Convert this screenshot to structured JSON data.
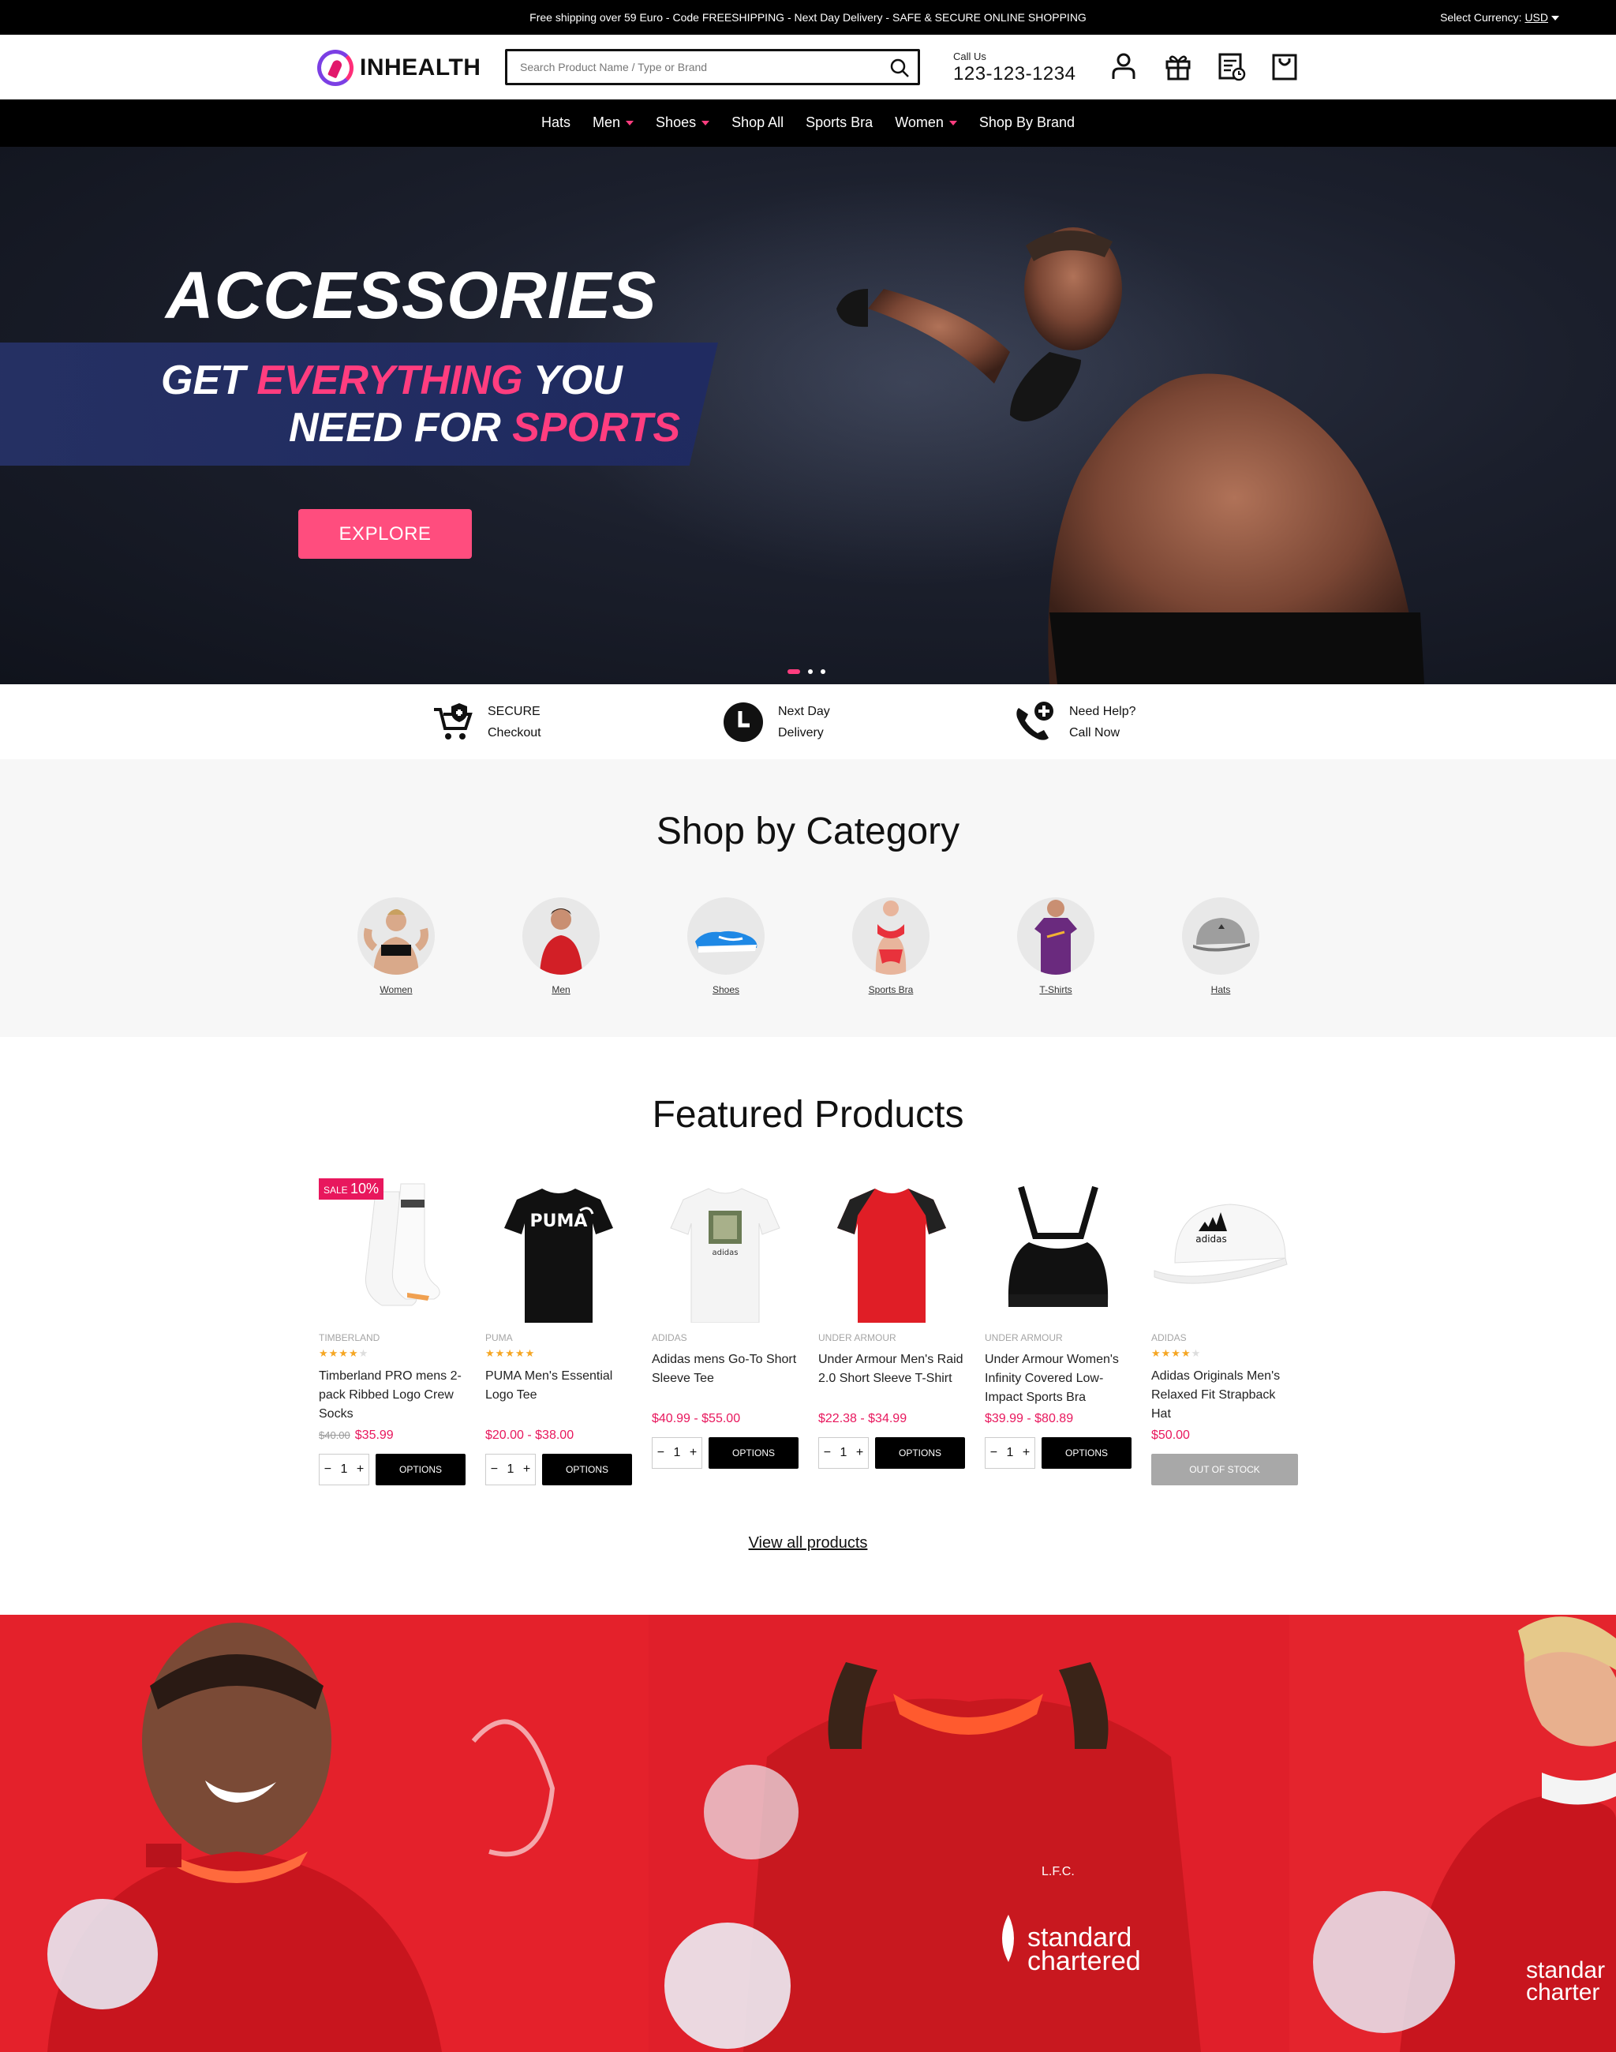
{
  "topbar": {
    "message": "Free shipping over 59 Euro - Code FREESHIPPING - Next Day Delivery - SAFE & SECURE ONLINE SHOPPING",
    "currency_label": "Select Currency:",
    "currency_value": "USD"
  },
  "header": {
    "logo_text": "INHEALTH",
    "search_placeholder": "Search Product Name / Type or Brand",
    "call_label": "Call Us",
    "phone": "123-123-1234",
    "icons": [
      "user-icon",
      "gift-icon",
      "compare-icon",
      "bag-icon"
    ]
  },
  "nav": {
    "items": [
      {
        "label": "Hats",
        "dropdown": false
      },
      {
        "label": "Men",
        "dropdown": true
      },
      {
        "label": "Shoes",
        "dropdown": true
      },
      {
        "label": "Shop All",
        "dropdown": false
      },
      {
        "label": "Sports Bra",
        "dropdown": false
      },
      {
        "label": "Women",
        "dropdown": true
      },
      {
        "label": "Shop By Brand",
        "dropdown": false
      }
    ]
  },
  "hero": {
    "title": "ACCESSORIES",
    "line1_a": "GET ",
    "line1_b": "EVERYTHING",
    "line1_c": " YOU",
    "line2_a": "NEED FOR ",
    "line2_b": "SPORTS",
    "button": "EXPLORE",
    "slides": 3,
    "active_slide": 1
  },
  "features": [
    {
      "line1": "SECURE",
      "line2": "Checkout",
      "icon": "cart-shield-icon"
    },
    {
      "line1": "Next Day",
      "line2": "Delivery",
      "icon": "clock-icon"
    },
    {
      "line1": "Need Help?",
      "line2": "Call Now",
      "icon": "phone-plus-icon"
    }
  ],
  "categories": {
    "title": "Shop by Category",
    "items": [
      "Women",
      "Men",
      "Shoes",
      "Sports Bra",
      "T-Shirts",
      "Hats"
    ]
  },
  "featured": {
    "title": "Featured Products",
    "view_all": "View all products",
    "products": [
      {
        "brand": "TIMBERLAND",
        "rating": 4,
        "name": "Timberland PRO mens 2-pack Ribbed Logo Crew Socks",
        "old_price": "$40.00",
        "price": "$35.99",
        "badge_prefix": "SALE",
        "badge_value": "10%",
        "qty": "1",
        "button": "OPTIONS",
        "in_stock": true
      },
      {
        "brand": "PUMA",
        "rating": 5,
        "name": "PUMA Men's Essential Logo Tee",
        "old_price": "",
        "price": "$20.00 - $38.00",
        "qty": "1",
        "button": "OPTIONS",
        "in_stock": true
      },
      {
        "brand": "ADIDAS",
        "rating": 0,
        "name": "Adidas mens Go-To Short Sleeve Tee",
        "old_price": "",
        "price": "$40.99 - $55.00",
        "qty": "1",
        "button": "OPTIONS",
        "in_stock": true
      },
      {
        "brand": "UNDER ARMOUR",
        "rating": 0,
        "name": "Under Armour Men's Raid 2.0 Short Sleeve T-Shirt",
        "old_price": "",
        "price": "$22.38 - $34.99",
        "qty": "1",
        "button": "OPTIONS",
        "in_stock": true
      },
      {
        "brand": "UNDER ARMOUR",
        "rating": 0,
        "name": "Under Armour Women's Infinity Covered Low-Impact Sports Bra",
        "old_price": "",
        "price": "$39.99 - $80.89",
        "qty": "1",
        "button": "OPTIONS",
        "in_stock": true
      },
      {
        "brand": "ADIDAS",
        "rating": 4,
        "name": "Adidas Originals Men's Relaxed Fit Strapback Hat",
        "old_price": "",
        "price": "$50.00",
        "qty": "",
        "button": "OUT OF STOCK",
        "in_stock": false
      }
    ]
  },
  "banner": {
    "sponsor_line1": "standard",
    "sponsor_line2": "chartered",
    "crest_text": "L.F.C."
  },
  "colors": {
    "accent": "#ff3d7f",
    "sale": "#e8175d",
    "star": "#f5a623",
    "banner_red": "#e11f26"
  }
}
